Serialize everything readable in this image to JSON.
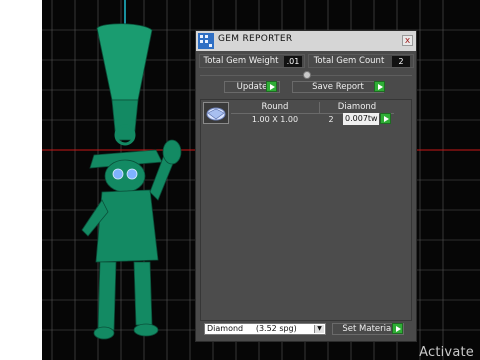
{
  "window": {
    "title": "GEM REPORTER",
    "close_glyph": "x"
  },
  "totals": {
    "weight_label": "Total Gem Weight",
    "weight_value": ".01",
    "count_label": "Total Gem Count",
    "count_value": "2"
  },
  "actions": {
    "update_label": "Update",
    "save_report_label": "Save Report"
  },
  "table": {
    "columns": [
      "Round",
      "Diamond"
    ],
    "rows": [
      {
        "thumb_icon": "round-gem-icon",
        "size": "1.00 X 1.00",
        "count": "2",
        "weight": "0.007tw"
      }
    ]
  },
  "material": {
    "selected": "Diamond     (3.52 spg)",
    "set_label": "Set Material"
  },
  "watermark": "Activate",
  "colors": {
    "model": "#138a63",
    "accent_go": "#2fae36",
    "title_bar": "#d6d6d6",
    "grid": "#7a7a7a",
    "axis_red": "#c81818",
    "axis_cyan": "#1fbfd0"
  }
}
